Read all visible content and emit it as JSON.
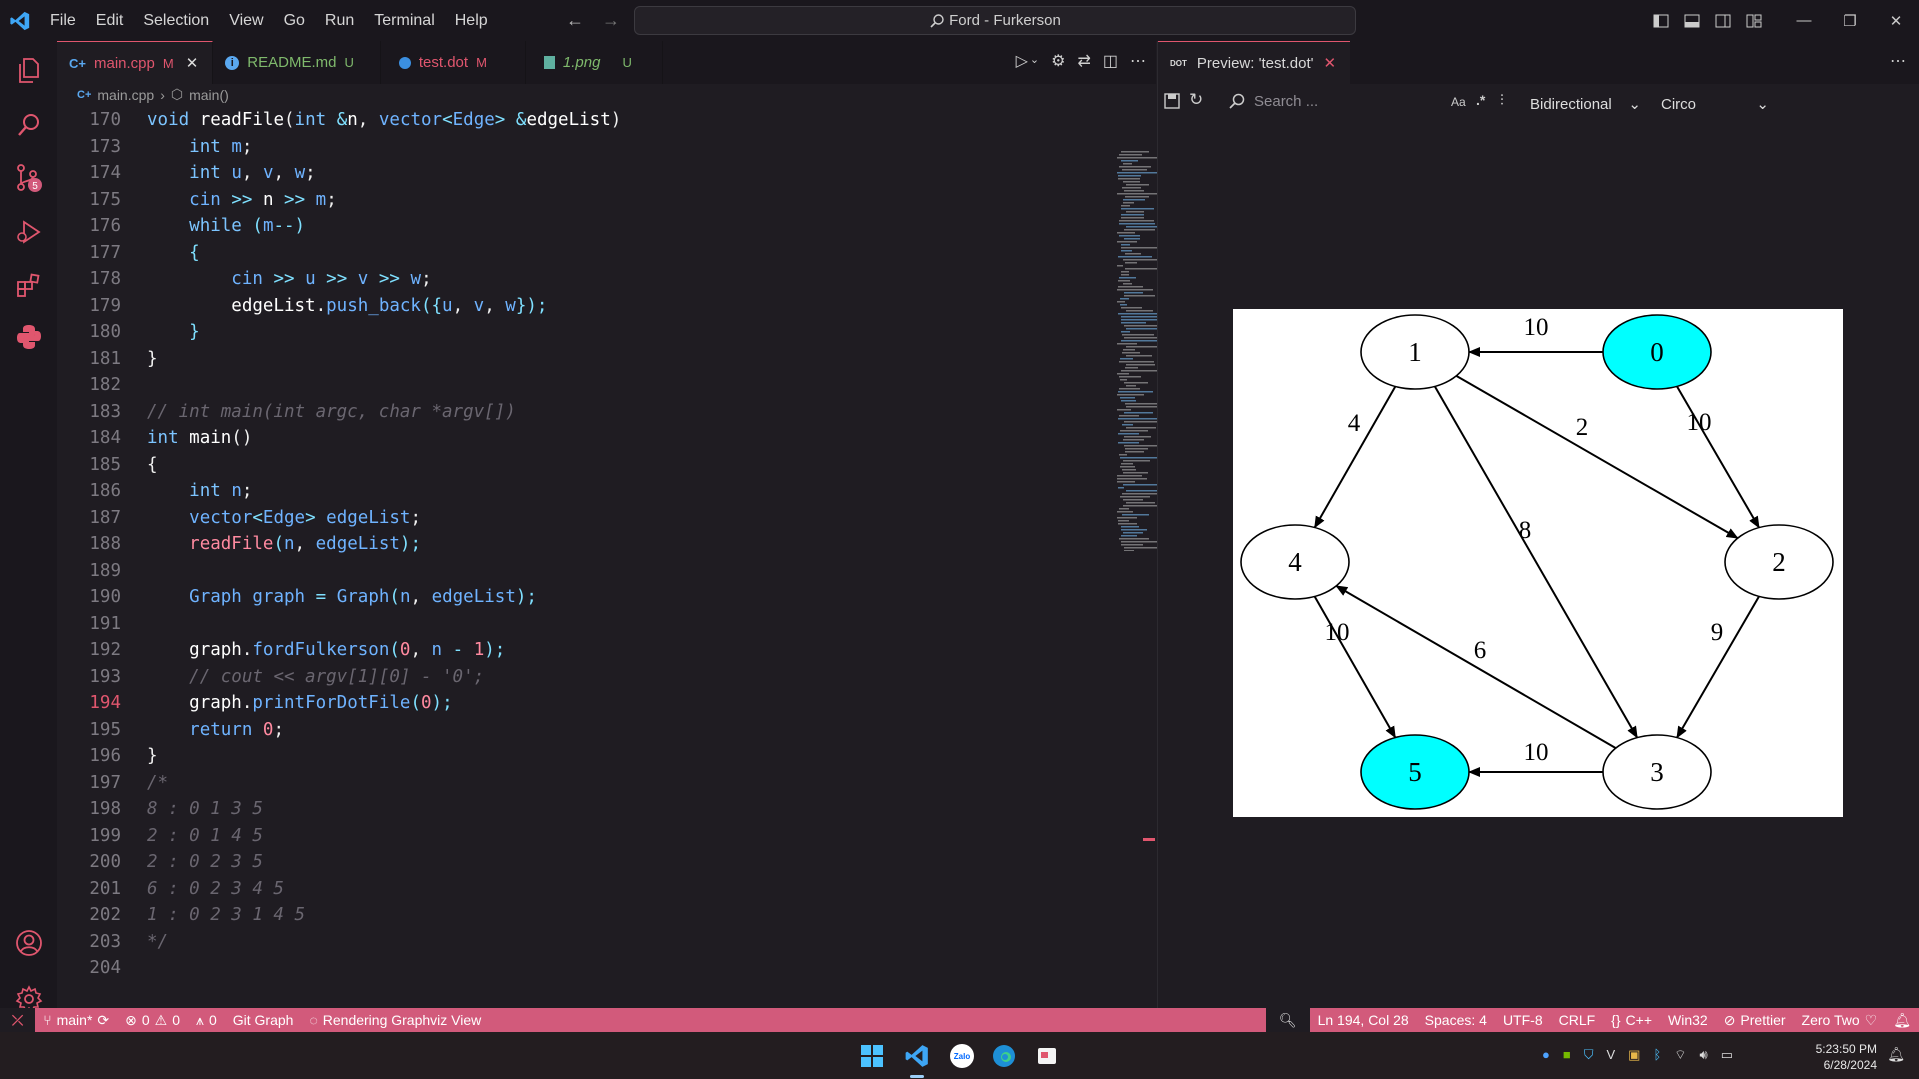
{
  "menu": [
    "File",
    "Edit",
    "Selection",
    "View",
    "Go",
    "Run",
    "Terminal",
    "Help"
  ],
  "command_center": "Ford - Furkerson",
  "tabs": [
    {
      "label": "main.cpp",
      "status": "M",
      "color": "#e0566e"
    },
    {
      "label": "README.md",
      "status": "U",
      "color": "#7fb96c"
    },
    {
      "label": "test.dot",
      "status": "M",
      "color": "#e0566e"
    },
    {
      "label": "1.png",
      "status": "U",
      "color": "#7fb96c"
    }
  ],
  "breadcrumb": {
    "file": "main.cpp",
    "symbol": "main()"
  },
  "code_lines": [
    {
      "n": "170",
      "html": "<span class='kw'>void</span> <span class='fn'>readFile</span><span class='pn'>(</span><span class='kw'>int</span> <span class='op'>&amp;</span><span class='fn'>n</span><span class='pn'>, </span><span class='vr'>vector</span><span class='op'>&lt;</span><span class='vr'>Edge</span><span class='op'>&gt;</span> <span class='op'>&amp;</span><span class='fn'>edgeList</span><span class='pn'>)</span>"
    },
    {
      "n": "173",
      "html": "    <span class='kw'>int</span> <span class='vr'>m</span>;"
    },
    {
      "n": "174",
      "html": "    <span class='kw'>int</span> <span class='vr'>u</span>, <span class='vr'>v</span>, <span class='vr'>w</span>;"
    },
    {
      "n": "175",
      "html": "    <span class='vr'>cin</span> <span class='op'>&gt;&gt;</span> <span class='fn'>n</span> <span class='op'>&gt;&gt;</span> <span class='vr'>m</span>;"
    },
    {
      "n": "176",
      "html": "    <span class='kw'>while</span> <span class='op'>(</span><span class='vr'>m</span><span class='op'>--)</span>"
    },
    {
      "n": "177",
      "html": "    <span class='op'>{</span>"
    },
    {
      "n": "178",
      "html": "        <span class='vr'>cin</span> <span class='op'>&gt;&gt;</span> <span class='vr'>u</span> <span class='op'>&gt;&gt;</span> <span class='vr'>v</span> <span class='op'>&gt;&gt;</span> <span class='vr'>w</span>;"
    },
    {
      "n": "179",
      "html": "        <span class='fn'>edgeList</span>.<span class='vr'>push_back</span><span class='op'>({</span><span class='vr'>u</span>, <span class='vr'>v</span>, <span class='vr'>w</span><span class='op'>});</span>"
    },
    {
      "n": "180",
      "html": "    <span class='op'>}</span>"
    },
    {
      "n": "181",
      "html": "<span class='pn'>}</span>"
    },
    {
      "n": "182",
      "html": ""
    },
    {
      "n": "183",
      "html": "<span class='cm'>// int main(int argc, char *argv[])</span>"
    },
    {
      "n": "184",
      "html": "<span class='kw'>int</span> <span class='fn'>main</span><span class='pn'>()</span>"
    },
    {
      "n": "185",
      "html": "<span class='pn'>{</span>"
    },
    {
      "n": "186",
      "html": "    <span class='kw'>int</span> <span class='vr'>n</span>;"
    },
    {
      "n": "187",
      "html": "    <span class='vr'>vector</span><span class='op'>&lt;</span><span class='vr'>Edge</span><span class='op'>&gt;</span> <span class='vr'>edgeList</span>;"
    },
    {
      "n": "188",
      "html": "    <span class='nm'>readFile</span><span class='op'>(</span><span class='vr'>n</span>, <span class='vr'>edgeList</span><span class='op'>);</span>"
    },
    {
      "n": "189",
      "html": ""
    },
    {
      "n": "190",
      "html": "    <span class='vr'>Graph</span> <span class='vr'>graph</span> <span class='op'>=</span> <span class='vr'>Graph</span><span class='op'>(</span><span class='vr'>n</span>, <span class='vr'>edgeList</span><span class='op'>);</span>"
    },
    {
      "n": "191",
      "html": ""
    },
    {
      "n": "192",
      "html": "    <span class='fn'>graph</span>.<span class='vr'>fordFulkerson</span><span class='op'>(</span><span class='nm'>0</span>, <span class='vr'>n</span> <span class='op'>-</span> <span class='nm'>1</span><span class='op'>);</span>"
    },
    {
      "n": "193",
      "html": "    <span class='cm'>// cout &lt;&lt; argv[1][0] - '0';</span>"
    },
    {
      "n": "194",
      "html": "    <span class='fn'>graph</span>.<span class='vr'>printForDotFile</span><span class='op'>(</span><span class='nm'>0</span><span class='op'>);</span>",
      "cur": true
    },
    {
      "n": "195",
      "html": "    <span class='vr'>return</span> <span class='nm'>0</span>;"
    },
    {
      "n": "196",
      "html": "<span class='pn'>}</span>"
    },
    {
      "n": "197",
      "html": "<span class='cm'>/*</span>"
    },
    {
      "n": "198",
      "html": "<span class='cm'>8 : 0 1 3 5</span>"
    },
    {
      "n": "199",
      "html": "<span class='cm'>2 : 0 1 4 5</span>"
    },
    {
      "n": "200",
      "html": "<span class='cm'>2 : 0 2 3 5</span>"
    },
    {
      "n": "201",
      "html": "<span class='cm'>6 : 0 2 3 4 5</span>"
    },
    {
      "n": "202",
      "html": "<span class='cm'>1 : 0 2 3 1 4 5</span>"
    },
    {
      "n": "203",
      "html": "<span class='cm'>*/</span>"
    },
    {
      "n": "204",
      "html": ""
    }
  ],
  "preview": {
    "tab_label": "Preview: 'test.dot'",
    "tab_badge": "DOT",
    "search_placeholder": "Search ...",
    "direction": "Bidirectional",
    "layout": "Circo",
    "case_icon": "Aa",
    "regex_icon": ".*"
  },
  "graph": {
    "nodes": [
      {
        "id": "0",
        "fill": "#00ffff"
      },
      {
        "id": "1",
        "fill": "#ffffff"
      },
      {
        "id": "2",
        "fill": "#ffffff"
      },
      {
        "id": "3",
        "fill": "#ffffff"
      },
      {
        "id": "4",
        "fill": "#ffffff"
      },
      {
        "id": "5",
        "fill": "#00ffff"
      }
    ],
    "edges": [
      {
        "from": "0",
        "to": "1",
        "label": "10"
      },
      {
        "from": "0",
        "to": "2",
        "label": "10"
      },
      {
        "from": "1",
        "to": "4",
        "label": "4"
      },
      {
        "from": "1",
        "to": "2",
        "label": "2"
      },
      {
        "from": "1",
        "to": "3",
        "label": "8"
      },
      {
        "from": "2",
        "to": "3",
        "label": "9"
      },
      {
        "from": "3",
        "to": "4",
        "label": "6"
      },
      {
        "from": "4",
        "to": "5",
        "label": "10"
      },
      {
        "from": "3",
        "to": "5",
        "label": "10"
      }
    ]
  },
  "status": {
    "branch": "main*",
    "errors": "0",
    "warnings": "0",
    "ports": "0",
    "git_graph": "Git Graph",
    "rendering": "Rendering Graphviz View",
    "position": "Ln 194, Col 28",
    "spaces": "Spaces: 4",
    "encoding": "UTF-8",
    "eol": "CRLF",
    "language": "C++",
    "platform": "Win32",
    "prettier": "Prettier",
    "theme": "Zero Two"
  },
  "scm_badge": "5",
  "clock": {
    "time": "5:23:50 PM",
    "date": "6/28/2024"
  },
  "taskbar_zalo": "Zalo"
}
